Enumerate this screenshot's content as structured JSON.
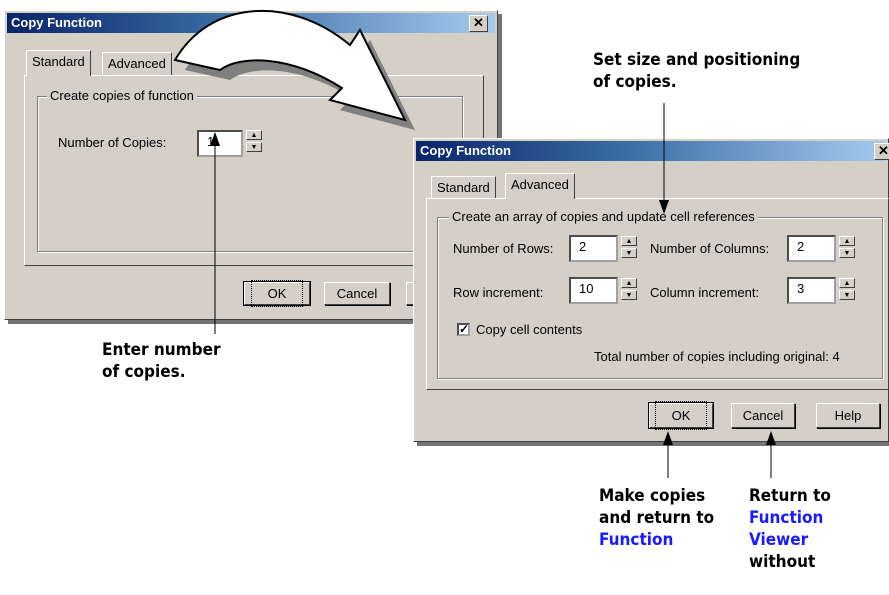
{
  "dialog1": {
    "title": "Copy Function",
    "tabs": {
      "standard": "Standard",
      "advanced": "Advanced"
    },
    "group": "Create copies of function",
    "copies_label": "Number of Copies:",
    "copies_value": "1",
    "buttons": {
      "ok": "OK",
      "cancel": "Cancel"
    }
  },
  "dialog2": {
    "title": "Copy Function",
    "tabs": {
      "standard": "Standard",
      "advanced": "Advanced"
    },
    "group": "Create an array of copies and update cell references",
    "rows_label": "Number of Rows:",
    "rows_value": "2",
    "columns_label": "Number of Columns:",
    "columns_value": "2",
    "row_inc_label": "Row increment:",
    "row_inc_value": "10",
    "col_inc_label": "Column increment:",
    "col_inc_value": "3",
    "copy_contents_label": "Copy cell contents",
    "copy_contents_checked": true,
    "total_text": "Total number of copies including original: 4",
    "buttons": {
      "ok": "OK",
      "cancel": "Cancel",
      "help": "Help"
    }
  },
  "callouts": {
    "set_size": [
      "Set size and positioning",
      "of copies."
    ],
    "enter_number": [
      "Enter number",
      "of copies."
    ],
    "make_copies": [
      "Make copies",
      "and return to",
      "Function"
    ],
    "return_to": [
      "Return to",
      "Function",
      "Viewer",
      "without"
    ]
  },
  "colors": {
    "callout_link": "#1a1aff",
    "title_start": "#0a246a",
    "title_end": "#a6caf0"
  }
}
